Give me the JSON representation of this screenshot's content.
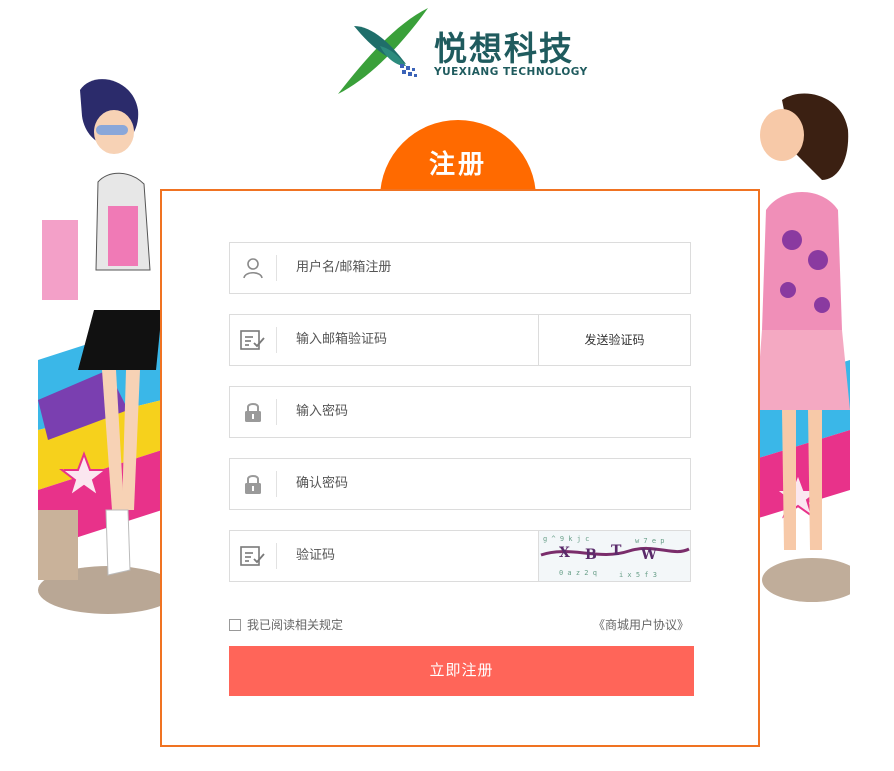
{
  "brand": {
    "name_cn": "悦想科技",
    "name_en": "YUEXIANG TECHNOLOGY",
    "logo_icon": "x-leaf-logo",
    "colors": {
      "green": "#3aa03a",
      "teal": "#1f5b5e",
      "orange": "#ff6a00"
    }
  },
  "tab": {
    "label": "注册"
  },
  "form": {
    "username": {
      "placeholder": "用户名/邮箱注册",
      "icon": "user-icon"
    },
    "email_code": {
      "placeholder": "输入邮箱验证码",
      "icon": "verify-icon",
      "send_label": "发送验证码"
    },
    "password": {
      "placeholder": "输入密码",
      "icon": "lock-icon"
    },
    "confirm": {
      "placeholder": "确认密码",
      "icon": "lock-icon"
    },
    "captcha": {
      "placeholder": "验证码",
      "icon": "verify-icon",
      "image_text": "X B T W"
    },
    "agree_label": "我已阅读相关规定",
    "agree_checked": false,
    "protocol_link": "《商城用户协议》",
    "submit_label": "立即注册"
  },
  "theme": {
    "card_border": "#f07322",
    "button": "#ff6559"
  }
}
